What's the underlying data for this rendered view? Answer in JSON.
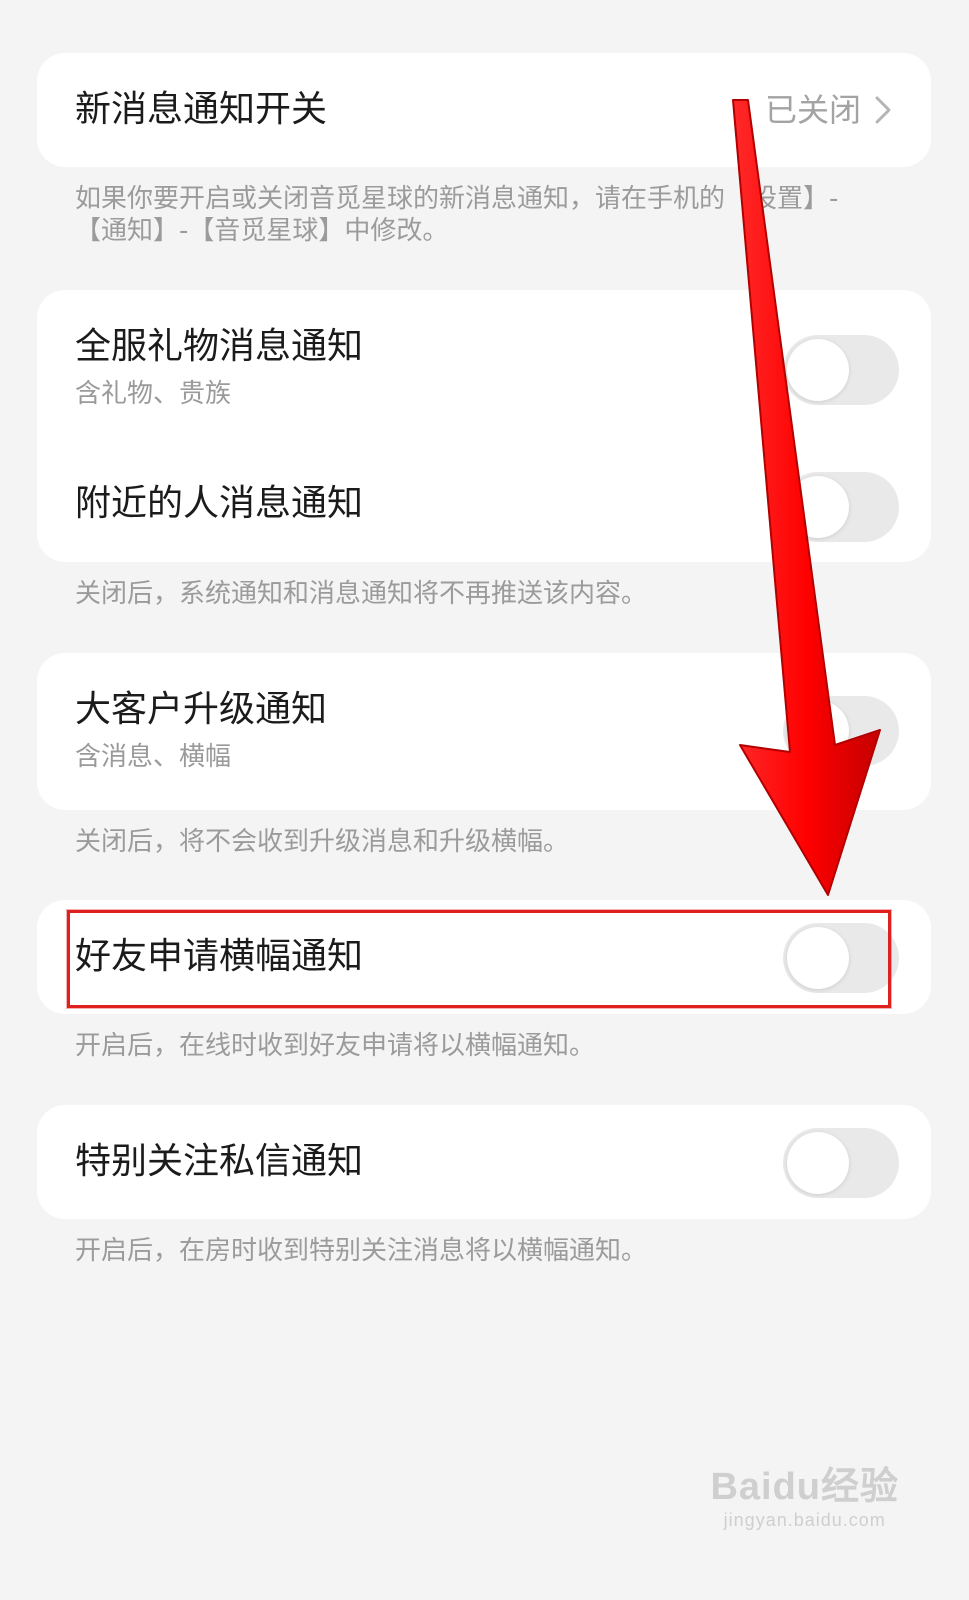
{
  "new_message_notification": {
    "label": "新消息通知开关",
    "value": "已关闭",
    "description": "如果你要开启或关闭音觅星球的新消息通知，请在手机的【设置】-【通知】-【音觅星球】中修改。"
  },
  "group_broadcast": {
    "items": [
      {
        "label": "全服礼物消息通知",
        "sub": "含礼物、贵族",
        "enabled": false
      },
      {
        "label": "附近的人消息通知",
        "sub": "",
        "enabled": false
      }
    ],
    "description": "关闭后，系统通知和消息通知将不再推送该内容。"
  },
  "vip_upgrade": {
    "label": "大客户升级通知",
    "sub": "含消息、横幅",
    "enabled": false,
    "description": "关闭后，将不会收到升级消息和升级横幅。"
  },
  "friend_request_banner": {
    "label": "好友申请横幅通知",
    "enabled": false,
    "description": "开启后，在线时收到好友申请将以横幅通知。"
  },
  "special_follow_dm": {
    "label": "特别关注私信通知",
    "enabled": false,
    "description": "开启后，在房时收到特别关注消息将以横幅通知。"
  },
  "colors": {
    "background": "#f4f4f4",
    "card": "#ffffff",
    "toggle_off": "#e9e9e9",
    "annotation_red": "#e0201f"
  },
  "watermark": {
    "brand": "Baidu经验",
    "url": "jingyan.baidu.com"
  }
}
